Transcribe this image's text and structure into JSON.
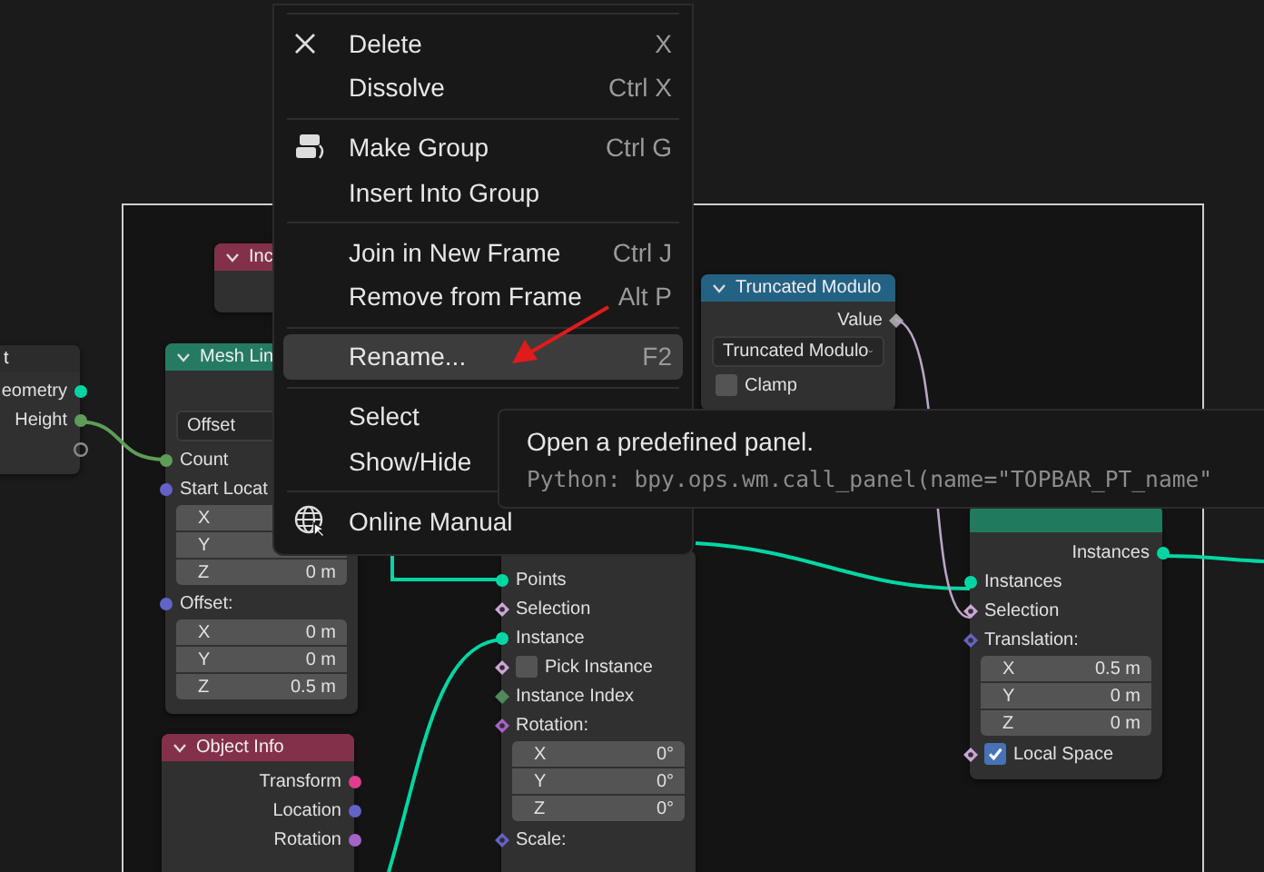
{
  "nodes": [
    {
      "title": "t",
      "color": "#2c2c2c",
      "rows": [
        {
          "kind": "output",
          "label": "eometry",
          "socket": {
            "kind": "circle",
            "color": "#00d6a3"
          }
        },
        {
          "kind": "output",
          "label": "Height",
          "socket": {
            "kind": "circle",
            "color": "#5f9c58"
          }
        },
        {
          "kind": "output",
          "socket": {
            "kind": "hollow",
            "color": "#8a8a8a"
          }
        }
      ]
    },
    {
      "title": "Inc",
      "color": "#83314a"
    },
    {
      "title": "Mesh Lin",
      "color": "#257a62",
      "rows": [
        {
          "kind": "dropdown",
          "label": "Offset"
        },
        {
          "kind": "input",
          "label": "Count",
          "socket": {
            "kind": "circle",
            "color": "#5f9c58"
          }
        },
        {
          "kind": "input",
          "label": "Start Locat",
          "socket": {
            "kind": "circle",
            "color": "#6363c7"
          }
        },
        {
          "kind": "vector",
          "fields": [
            {
              "axis": "X"
            },
            {
              "axis": "Y"
            },
            {
              "axis": "Z",
              "value": "0 m"
            }
          ]
        },
        {
          "kind": "input",
          "label": "Offset:",
          "socket": {
            "kind": "circle",
            "color": "#6363c7"
          }
        },
        {
          "kind": "vector",
          "fields": [
            {
              "axis": "X",
              "value": "0 m"
            },
            {
              "axis": "Y",
              "value": "0 m"
            },
            {
              "axis": "Z",
              "value": "0.5 m"
            }
          ]
        }
      ]
    },
    {
      "title": "Truncated Modulo",
      "color": "#246283",
      "rows": [
        {
          "kind": "output",
          "label": "Value",
          "socket": {
            "kind": "diamond",
            "color": "#a1a1a1"
          }
        },
        {
          "kind": "dropdown",
          "label": "Truncated Modulo",
          "chevron": true
        },
        {
          "kind": "checkbox",
          "label": "Clamp",
          "checked": false
        }
      ]
    },
    {
      "rows": [
        {
          "kind": "input",
          "label": "Points",
          "socket": {
            "kind": "circle",
            "color": "#00d6a3"
          }
        },
        {
          "kind": "input",
          "label": "Selection",
          "socket": {
            "kind": "diamond-dot",
            "color": "#cca6d6"
          }
        },
        {
          "kind": "input",
          "label": "Instance",
          "socket": {
            "kind": "circle",
            "color": "#00d6a3"
          }
        },
        {
          "kind": "checkbox",
          "label": "Pick Instance",
          "checked": false,
          "socket": {
            "kind": "diamond-dot",
            "color": "#cca6d6"
          }
        },
        {
          "kind": "input",
          "label": "Instance Index",
          "socket": {
            "kind": "diamond",
            "color": "#4f8a5a"
          }
        },
        {
          "kind": "input",
          "label": "Rotation:",
          "socket": {
            "kind": "diamond-dot",
            "color": "#a463c7"
          }
        },
        {
          "kind": "vector",
          "fields": [
            {
              "axis": "X",
              "value": "0°"
            },
            {
              "axis": "Y",
              "value": "0°"
            },
            {
              "axis": "Z",
              "value": "0°"
            }
          ]
        },
        {
          "kind": "input",
          "label": "Scale:",
          "socket": {
            "kind": "diamond-dot",
            "color": "#6363c7"
          }
        }
      ]
    },
    {
      "color": "#1f7a5e",
      "rows": [
        {
          "kind": "output",
          "label": "Instances",
          "socket": {
            "kind": "circle",
            "color": "#00d6a3"
          }
        },
        {
          "kind": "input",
          "label": "Instances",
          "socket": {
            "kind": "circle",
            "color": "#00d6a3"
          }
        },
        {
          "kind": "input",
          "label": "Selection",
          "socket": {
            "kind": "diamond-dot",
            "color": "#cca6d6"
          }
        },
        {
          "kind": "input",
          "label": "Translation:",
          "socket": {
            "kind": "diamond-dot",
            "color": "#6363c7"
          }
        },
        {
          "kind": "vector",
          "fields": [
            {
              "axis": "X",
              "value": "0.5 m"
            },
            {
              "axis": "Y",
              "value": "0 m"
            },
            {
              "axis": "Z",
              "value": "0 m"
            }
          ]
        },
        {
          "kind": "checkbox",
          "label": "Local Space",
          "checked": true,
          "socket": {
            "kind": "diamond-dot",
            "color": "#cca6d6"
          }
        }
      ]
    },
    {
      "title": "Object Info",
      "color": "#83314a",
      "rows": [
        {
          "kind": "output",
          "label": "Transform",
          "socket": {
            "kind": "circle",
            "color": "#e03d8e"
          }
        },
        {
          "kind": "output",
          "label": "Location",
          "socket": {
            "kind": "circle",
            "color": "#6363c7"
          }
        },
        {
          "kind": "output",
          "label": "Rotation",
          "socket": {
            "kind": "circle",
            "color": "#a463c7"
          }
        }
      ]
    }
  ],
  "menu": {
    "sections": [
      [
        {
          "label": "Delete",
          "shortcut": "X",
          "selected": false
        },
        {
          "label": "Dissolve",
          "shortcut": "Ctrl X",
          "selected": false
        }
      ],
      [
        {
          "label": "Make Group",
          "shortcut": "Ctrl G",
          "selected": false
        },
        {
          "label": "Insert Into Group",
          "selected": false
        }
      ],
      [
        {
          "label": "Join in New Frame",
          "shortcut": "Ctrl J",
          "selected": false
        },
        {
          "label": "Remove from Frame",
          "shortcut": "Alt P",
          "selected": false
        }
      ],
      [
        {
          "label": "Rename...",
          "shortcut": "F2",
          "selected": true
        }
      ],
      [
        {
          "label": "Select",
          "selected": false
        },
        {
          "label": "Show/Hide",
          "selected": false
        }
      ],
      [
        {
          "label": "Online Manual",
          "selected": false
        }
      ]
    ]
  },
  "tooltip": {
    "description": "Open a predefined panel.",
    "python": "Python: bpy.ops.wm.call_panel(name=\"TOPBAR_PT_name\""
  }
}
